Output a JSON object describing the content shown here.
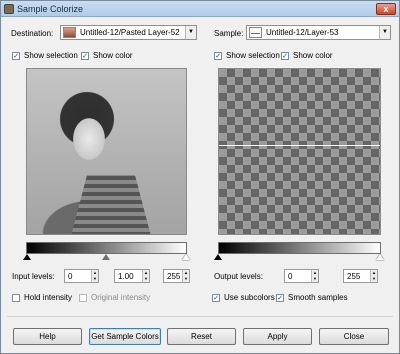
{
  "window": {
    "title": "Sample Colorize",
    "close_glyph": "x"
  },
  "destination": {
    "label": "Destination:",
    "value": "Untitled-12/Pasted Layer-52"
  },
  "sample": {
    "label": "Sample:",
    "value": "Untitled-12/Layer-53"
  },
  "left_options": {
    "show_selection": "Show selection",
    "show_color": "Show color"
  },
  "right_options": {
    "show_selection": "Show selection",
    "show_color": "Show color"
  },
  "input_levels": {
    "label": "Input levels:",
    "low": "0",
    "gamma": "1.00",
    "high": "255"
  },
  "output_levels": {
    "label": "Output levels:",
    "low": "0",
    "high": "255"
  },
  "checkboxes": {
    "hold_intensity": "Hold intensity",
    "original_intensity": "Original intensity",
    "use_subcolors": "Use subcolors",
    "smooth_samples": "Smooth samples"
  },
  "buttons": {
    "help": "Help",
    "get_sample_colors": "Get Sample Colors",
    "reset": "Reset",
    "apply": "Apply",
    "close": "Close"
  },
  "icons": {
    "check": "✓",
    "combo_arrow": "▼",
    "spin_up": "▲",
    "spin_down": "▼"
  }
}
